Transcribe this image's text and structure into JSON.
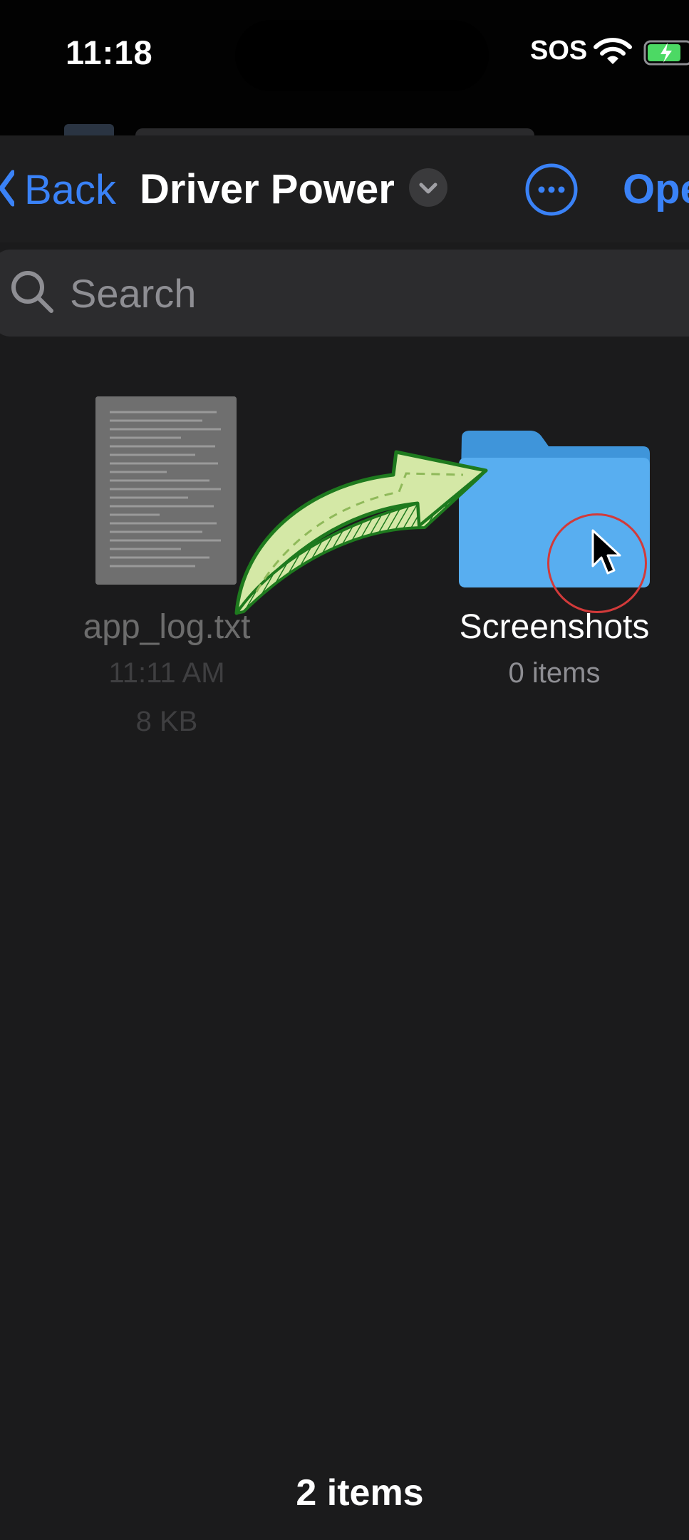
{
  "status_bar": {
    "time": "11:18",
    "carrier": "SOS"
  },
  "nav": {
    "back_label": "Back",
    "title": "Driver Power",
    "open_label": "Ope"
  },
  "search": {
    "placeholder": "Search"
  },
  "files": [
    {
      "name": "app_log.txt",
      "time": "11:11 AM",
      "size": "8 KB",
      "type": "text-file-icon"
    },
    {
      "name": "Screenshots",
      "count": "0 items",
      "type": "folder-icon"
    }
  ],
  "footer": {
    "item_count": "2 items"
  },
  "colors": {
    "accent": "#3a82f7",
    "background": "#1b1b1c",
    "folder": "#4aa3e8",
    "arrow_fill": "#d4e8a6",
    "arrow_stroke": "#1e7a1e",
    "click_ring": "#d23a3a"
  }
}
